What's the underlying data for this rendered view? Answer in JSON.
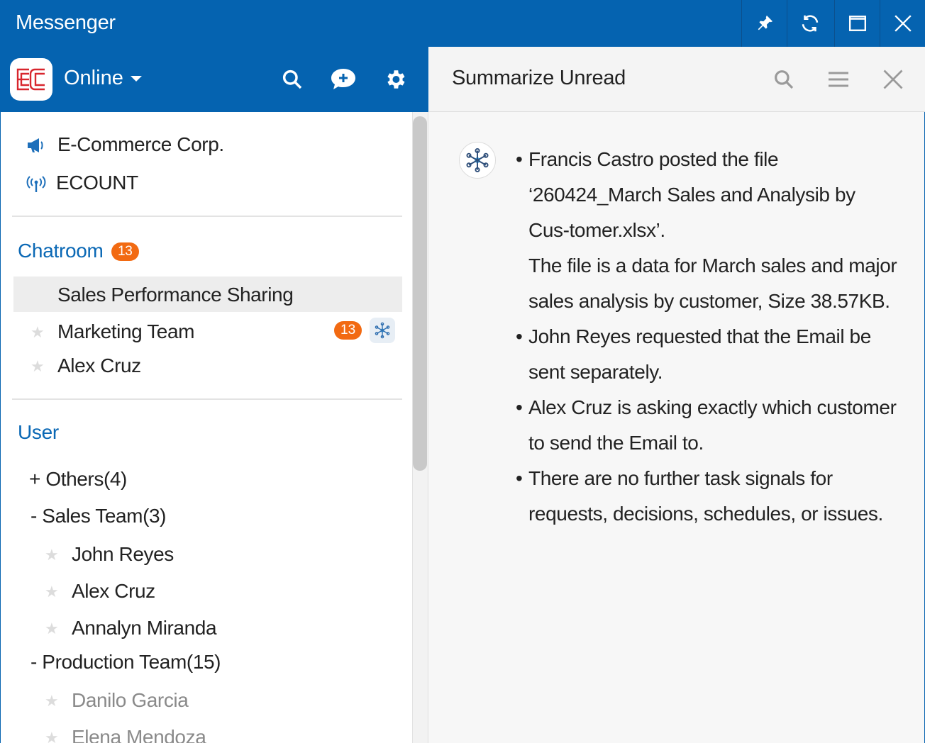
{
  "window": {
    "title": "Messenger",
    "icons": [
      "pin-icon",
      "refresh-icon",
      "maximize-icon",
      "close-icon"
    ]
  },
  "left_header": {
    "logo_text": "EC",
    "status": "Online",
    "icons": [
      "search-icon",
      "new-chat-icon",
      "gear-icon"
    ]
  },
  "sidebar": {
    "companies": [
      {
        "label": "E-Commerce Corp.",
        "icon": "megaphone-icon"
      },
      {
        "label": "ECOUNT",
        "icon": "broadcast-icon"
      }
    ],
    "chatroom_title": "Chatroom",
    "chatroom_badge": "13",
    "chatrooms": [
      {
        "label": "Sales Performance Sharing",
        "selected": true
      },
      {
        "label": "Marketing Team",
        "badge": "13",
        "ai": true
      },
      {
        "label": "Alex Cruz"
      }
    ],
    "user_title": "User",
    "groups": [
      {
        "label": "+ Others(4)"
      },
      {
        "label": "- Sales Team(3)",
        "members": [
          "John Reyes",
          "Alex Cruz",
          "Annalyn Miranda"
        ]
      },
      {
        "label": "- Production Team(15)",
        "members": [
          "Danilo Garcia",
          "Elena Mendoza"
        ]
      }
    ]
  },
  "right_panel": {
    "title": "Summarize Unread",
    "icons": [
      "search-icon",
      "menu-icon",
      "close-icon"
    ],
    "summary": [
      {
        "lines": [
          "Francis Castro posted the file ‘260424_March Sales and Analysib by Cus-tomer.xlsx’.",
          "The file is a data for March sales and major sales analysis by customer, Size 38.57KB."
        ]
      },
      {
        "lines": [
          "John Reyes requested that the Email be sent separately."
        ]
      },
      {
        "lines": [
          "Alex Cruz is asking exactly which customer to send the Email to."
        ]
      },
      {
        "lines": [
          "There are no further task signals for requests, decisions, schedules, or issues."
        ]
      }
    ]
  },
  "colors": {
    "brand": "#0563b0",
    "badge": "#f26a12",
    "section": "#0a68b5"
  }
}
